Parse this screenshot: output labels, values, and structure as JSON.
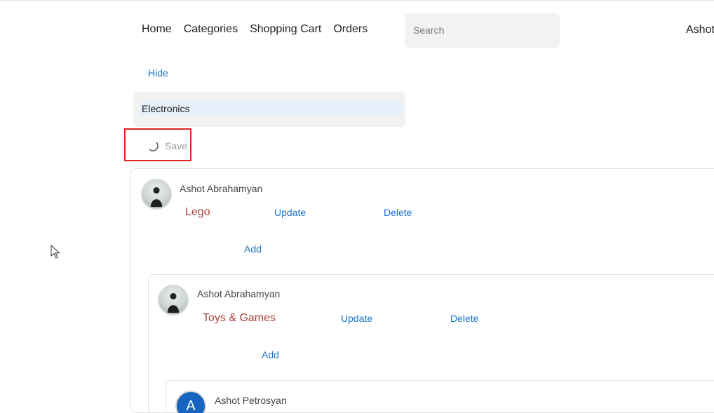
{
  "nav": {
    "items": [
      "Home",
      "Categories",
      "Shopping Cart",
      "Orders"
    ],
    "search_placeholder": "Search",
    "user_name": "Ashot"
  },
  "category_form": {
    "hide_label": "Hide",
    "name_value": "Electronics",
    "save_label": "Save",
    "save_state": "loading"
  },
  "comments": [
    {
      "author": "Ashot Abrahamyan",
      "text": "Lego",
      "update_label": "Update",
      "delete_label": "Delete",
      "add_label": "Add",
      "avatar": "photo"
    },
    {
      "author": "Ashot Abrahamyan",
      "text": "Toys & Games",
      "update_label": "Update",
      "delete_label": "Delete",
      "add_label": "Add",
      "avatar": "photo"
    },
    {
      "author": "Ashot Petrosyan",
      "avatar_letter": "A",
      "avatar": "letter"
    }
  ],
  "colors": {
    "link": "#1a73c8",
    "comment_text": "#a4453a",
    "highlight": "#e02424",
    "avatar_letter_bg": "#1565c0"
  }
}
